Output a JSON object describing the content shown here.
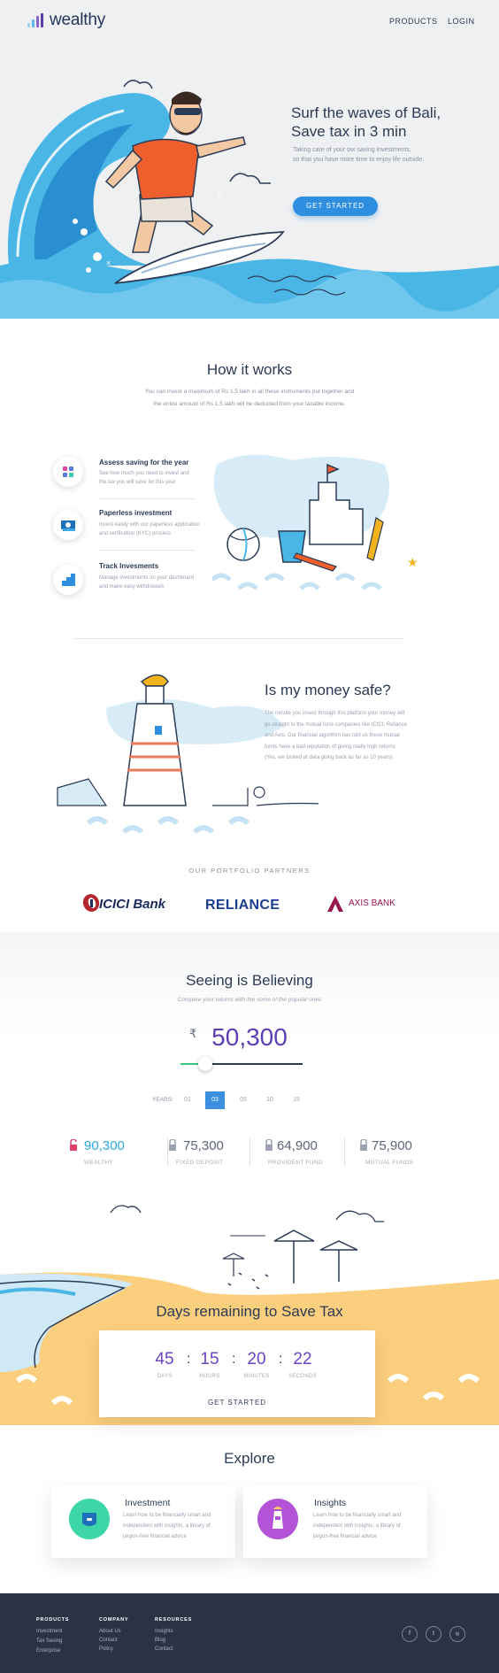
{
  "header": {
    "logo": "wealthy",
    "nav": [
      "PRODUCTS",
      "LOGIN"
    ]
  },
  "hero": {
    "title_line1": "Surf the waves of Bali,",
    "title_line2": "Save tax in 3 min",
    "subtitle_line1": "Taking care of your tax saving investments,",
    "subtitle_line2": "so that you have more time to enjoy life outside.",
    "cta": "GET STARTED"
  },
  "how": {
    "title": "How it works",
    "text_line1": "You can invest a maximum of Rs 1.5 lakh in all these instruments put together and",
    "text_line2": "the entire amount of Rs 1.5 lakh will be deducted from your taxable income.",
    "steps": [
      {
        "title": "Assess saving for the year",
        "text_line1": "See how much you need to invest and",
        "text_line2": "the tax you will save for this year",
        "icon": "grid-dots-icon"
      },
      {
        "title": "Paperless investment",
        "text_line1": "Invest easily with our paperless application",
        "text_line2": "and verification (KYC) process",
        "icon": "money-note-icon"
      },
      {
        "title": "Track Invesments",
        "text_line1": "Manage investments on your dashboard",
        "text_line2": "and make easy withdrawals",
        "icon": "steps-chart-icon"
      }
    ]
  },
  "safe": {
    "title": "Is my money safe?",
    "lines": [
      "The minute you invest through this platform your money will",
      "go straight to the mutual fund companies like ICICI, Reliance",
      "and Axis. Our financial algorithm has told us these mutual",
      "funds have a bad reputation of giving really high returns",
      "(Yes, we looked at data going back as far as 10 years)."
    ]
  },
  "partners": {
    "label": "OUR PORTFOLIO PARTNERS",
    "logos": [
      "ICICI Bank",
      "RELIANCE",
      "AXIS BANK"
    ]
  },
  "seeing": {
    "title": "Seeing is Believing",
    "subtitle": "Compare your returns with the some  of the popular ones",
    "currency": "₹",
    "amount": "50,300",
    "slider_fraction": 0.2,
    "years_label": "YEARS:",
    "years": [
      "01",
      "03",
      "05",
      "10",
      "15"
    ],
    "selected_year": "03",
    "stats": [
      {
        "value": "90,300",
        "label": "WEALTHY",
        "color": "#29a9e0"
      },
      {
        "value": "75,300",
        "label": "FIXED DEPOSIT",
        "color": "#5b6677"
      },
      {
        "value": "64,900",
        "label": "PROVIDENT FUND",
        "color": "#5b6677"
      },
      {
        "value": "75,900",
        "label": "MUTUAL FUNDS",
        "color": "#5b6677"
      }
    ]
  },
  "countdown": {
    "title": "Days remaining to Save Tax",
    "units": [
      {
        "value": "45",
        "label": "DAYS"
      },
      {
        "value": "15",
        "label": "HOURS"
      },
      {
        "value": "20",
        "label": "MINUTES"
      },
      {
        "value": "22",
        "label": "SECONDS"
      }
    ],
    "cta": "GET STARTED"
  },
  "explore": {
    "title": "Explore",
    "cards": [
      {
        "title": "Investment",
        "text_line1": "Learn how to be financially smart and",
        "text_line2": "independent with insights, a library of",
        "text_line3": "jargon-free financial advice",
        "color": "#3dd6a8"
      },
      {
        "title": "Insights",
        "text_line1": "Learn how to be financially smart and",
        "text_line2": "independent with insights, a library of",
        "text_line3": "jargon-free financial advice",
        "color": "#b453d8"
      }
    ]
  },
  "footer": {
    "columns": [
      {
        "head": "PRODUCTS",
        "links": [
          "Investment",
          "Tax Saving",
          "Enterprise"
        ]
      },
      {
        "head": "COMPANY",
        "links": [
          "About Us",
          "Contact",
          "Policy"
        ]
      },
      {
        "head": "RESOURCES",
        "links": [
          "Insights",
          "Blog",
          "Contact"
        ]
      }
    ],
    "social": [
      "f",
      "t",
      "ig"
    ]
  }
}
